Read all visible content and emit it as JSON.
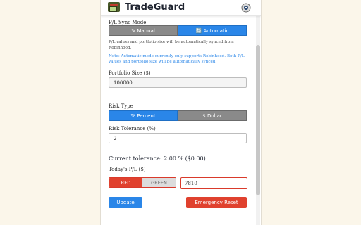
{
  "header": {
    "title": "TradeGuard",
    "settings_icon": "settings-icon"
  },
  "sync": {
    "label": "P/L Sync Mode",
    "manual": "✎ Manual",
    "automatic": "🔄 Automatic",
    "description": "P/L values and portfolio size will be automatically synced from Robinhood.",
    "note": "Note: Automatic mode currently only supports Robinhood. Both P/L values and portfolio size will be automatically synced."
  },
  "portfolio": {
    "label": "Portfolio Size ($)",
    "value": "100000"
  },
  "risk_type": {
    "label": "Risk Type",
    "percent": "% Percent",
    "dollar": "$ Dollar"
  },
  "risk_tolerance": {
    "label": "Risk Tolerance (%)",
    "value": "2"
  },
  "current_tolerance": "Current tolerance: 2.00 % ($0.00)",
  "pl": {
    "label": "Today's P/L ($)",
    "red": "RED",
    "green": "GREEN",
    "value": "7810"
  },
  "buttons": {
    "update": "Update",
    "emergency": "Emergency Reset"
  },
  "colors": {
    "accent": "#2a86e8",
    "danger": "#e0412e",
    "panel": "#ffffff",
    "background": "#fbf6ea"
  }
}
